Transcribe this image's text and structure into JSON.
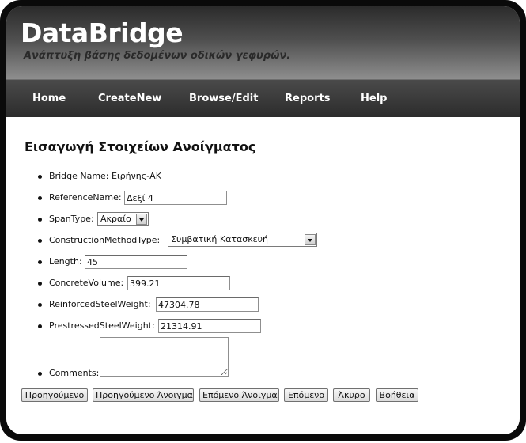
{
  "header": {
    "title": "DataBridge",
    "subtitle": "Ανάπτυξη βάσης δεδομένων οδικών γεφυρών."
  },
  "nav": {
    "items": [
      "Home",
      "CreateNew",
      "Browse/Edit",
      "Reports",
      "Help"
    ]
  },
  "form": {
    "heading": "Εισαγωγή Στοιχείων Ανοίγματος",
    "bridge_name_label": "Bridge Name:",
    "bridge_name_value": "Ειρήνης-ΑΚ",
    "reference_name_label": "ReferenceName:",
    "reference_name_value": "Δεξί 4",
    "span_type_label": "SpanType:",
    "span_type_value": "Ακραίο",
    "construction_method_label": "ConstructionMethodType:",
    "construction_method_value": "Συμβατική Κατασκευή",
    "length_label": "Length:",
    "length_value": "45",
    "concrete_volume_label": "ConcreteVolume:",
    "concrete_volume_value": "399.21",
    "reinforced_steel_label": "ReinforcedSteelWeight:",
    "reinforced_steel_value": "47304.78",
    "prestressed_steel_label": "PrestressedSteelWeight:",
    "prestressed_steel_value": "21314.91",
    "comments_label": "Comments:",
    "comments_value": ""
  },
  "buttons": {
    "previous": "Προηγούμενο",
    "previous_span": "Προηγούμενο Άνοιγμα",
    "next_span": "Επόμενο Άνοιγμα",
    "next": "Επόμενο",
    "cancel": "Άκυρο",
    "help": "Βοήθεια"
  },
  "icons": {
    "dropdown": "chevron-down-icon",
    "list_marker": "bullet-icon",
    "resize": "resize-grip-icon"
  },
  "colors": {
    "frame": "#0a0a0a",
    "header_top": "#2b2b2b",
    "header_bottom": "#8e8e8e",
    "nav_background": "#333333",
    "nav_text": "#ffffff",
    "subtitle_text": "#2a2a2a"
  }
}
